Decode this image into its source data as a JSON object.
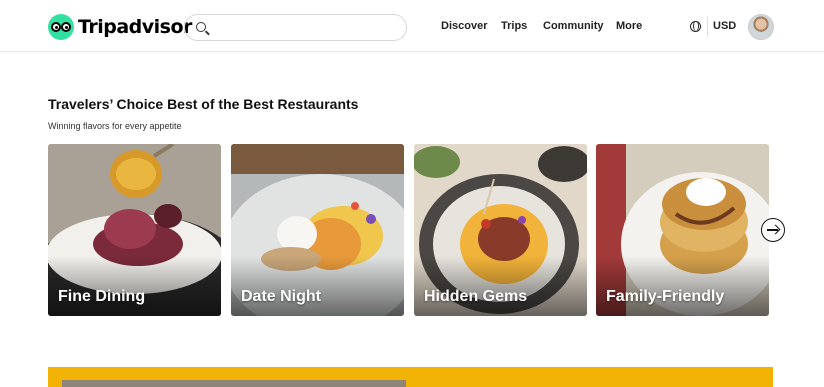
{
  "header": {
    "logo_text": "Tripadvisor",
    "search_placeholder": "",
    "nav": {
      "discover": "Discover",
      "trips": "Trips",
      "community": "Community",
      "more": "More"
    },
    "currency": "USD",
    "icons": [
      "tripadvisor-owl-icon",
      "search-icon",
      "globe-icon",
      "user-avatar"
    ]
  },
  "section": {
    "title": "Travelers’ Choice Best of the Best Restaurants",
    "subtitle": "Winning flavors for every appetite",
    "cards": [
      {
        "label": "Fine Dining"
      },
      {
        "label": "Date Night"
      },
      {
        "label": "Hidden Gems"
      },
      {
        "label": "Family-Friendly"
      }
    ]
  },
  "colors": {
    "brand_green": "#34e0a1",
    "promo_yellow": "#f2b203"
  }
}
